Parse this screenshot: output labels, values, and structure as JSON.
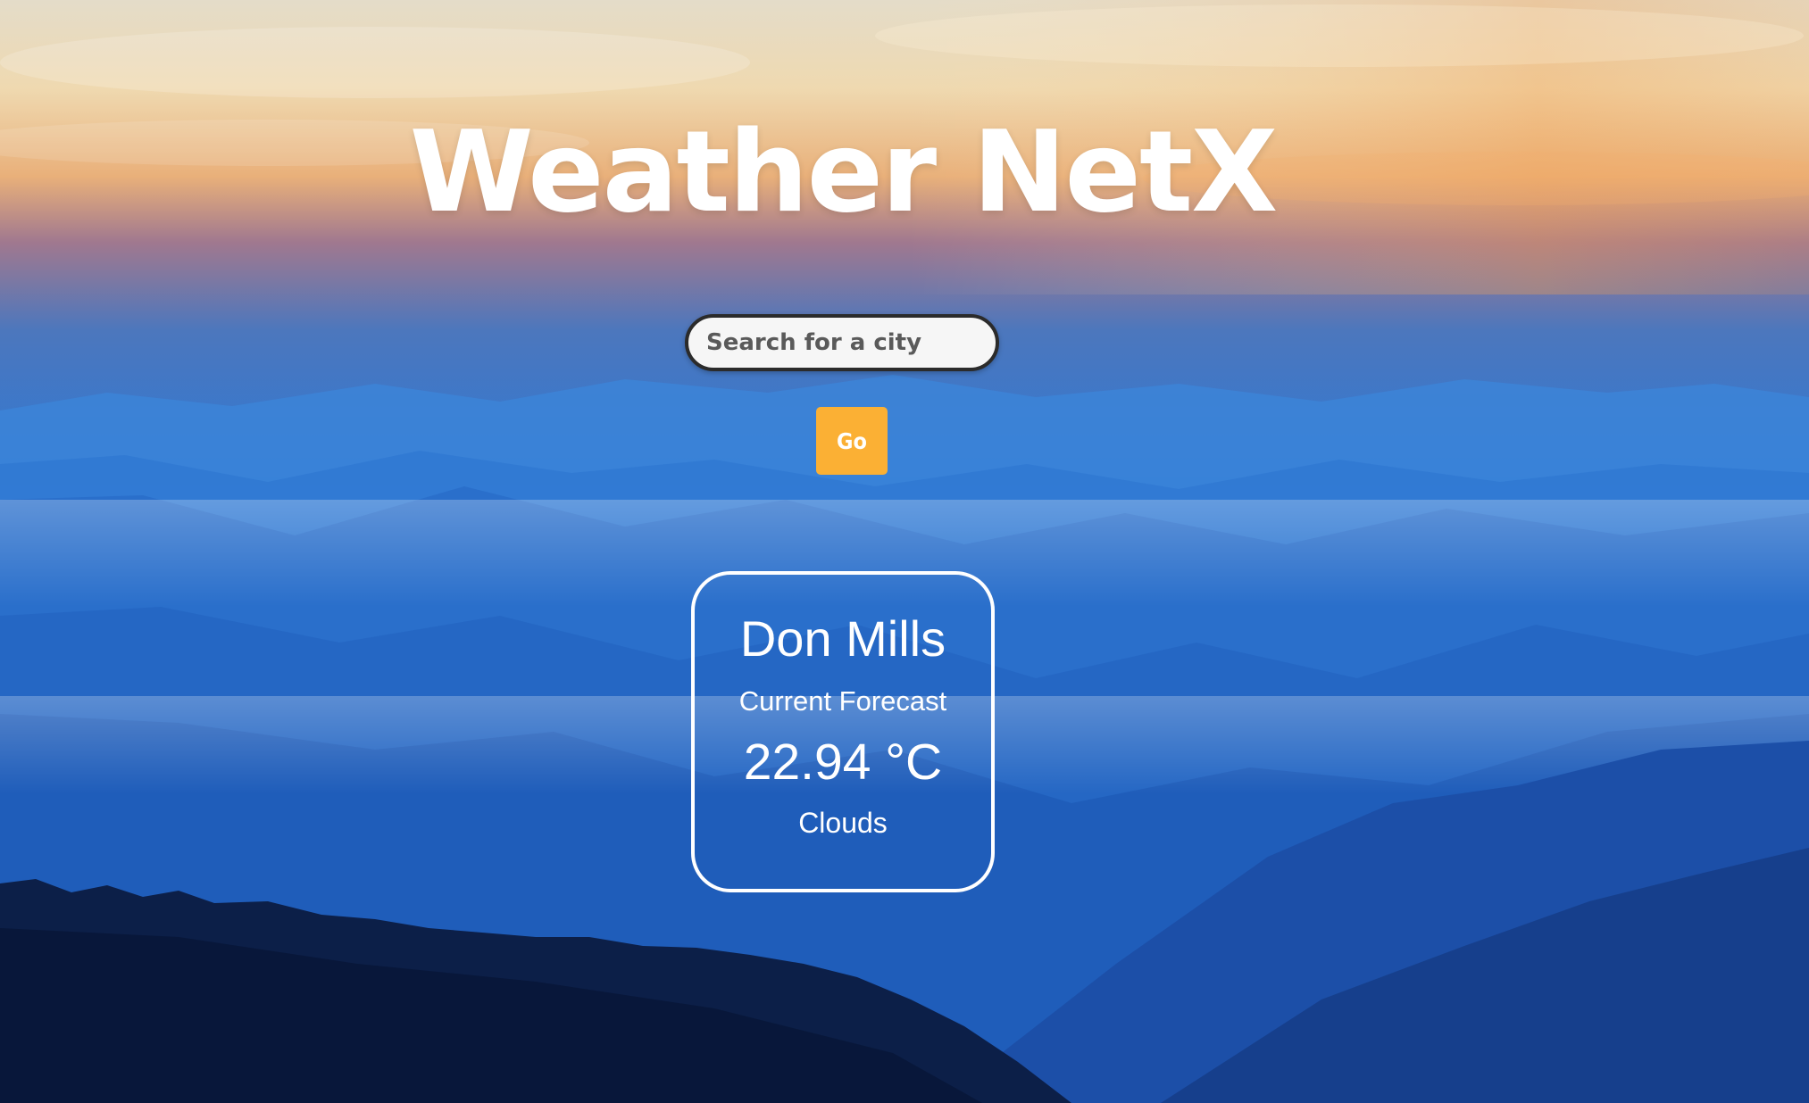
{
  "app": {
    "title": "Weather NetX"
  },
  "search": {
    "placeholder": "Search for a city",
    "value": ""
  },
  "go_button": {
    "label": "Go"
  },
  "weather_card": {
    "city": "Don Mills",
    "subtitle": "Current Forecast",
    "temperature": "22.94 °C",
    "condition": "Clouds"
  },
  "colors": {
    "accent_button": "#fbb034",
    "text": "#ffffff",
    "sky_top": "#e9dcc0",
    "sky_glow": "#e89a5a",
    "mountains": "#1f63c8",
    "foreground_ridge": "#0b1e45"
  },
  "background": {
    "description_icon": "mountain-landscape-background"
  }
}
